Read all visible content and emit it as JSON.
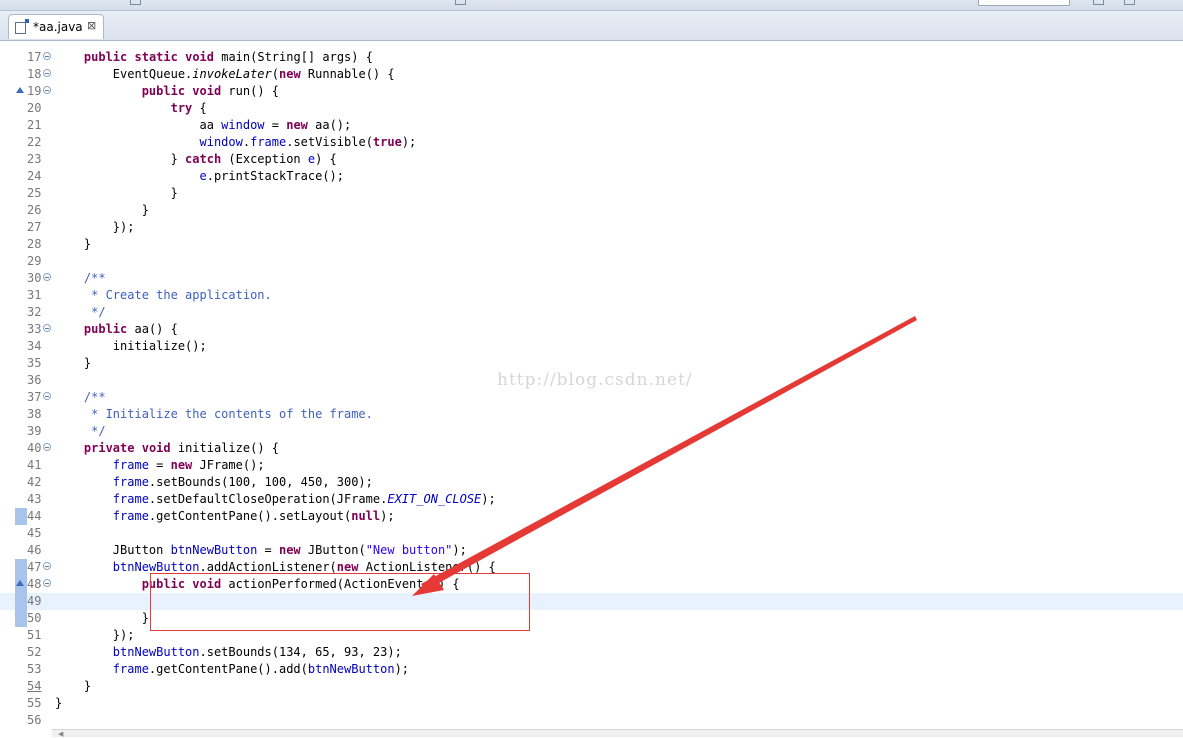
{
  "tab": {
    "label": "*aa.java",
    "close_glyph": "⊠"
  },
  "watermark": "http://blog.csdn.net/",
  "colors": {
    "keyword": "#7f0055",
    "field": "#0000c0",
    "string": "#2a00ff",
    "comment": "#3f5fbf",
    "annotation": "#e53935",
    "current_line": "#e8f2fe"
  },
  "lines": [
    {
      "n": "17",
      "fold": true,
      "tokens": [
        {
          "t": "    "
        },
        {
          "t": "public",
          "c": "kw"
        },
        {
          "t": " "
        },
        {
          "t": "static",
          "c": "kw"
        },
        {
          "t": " "
        },
        {
          "t": "void",
          "c": "kw"
        },
        {
          "t": " main(String[] args) {"
        }
      ]
    },
    {
      "n": "18",
      "fold": true,
      "tokens": [
        {
          "t": "        EventQueue."
        },
        {
          "t": "invokeLater",
          "c": "it"
        },
        {
          "t": "("
        },
        {
          "t": "new",
          "c": "kw"
        },
        {
          "t": " Runnable() {"
        }
      ]
    },
    {
      "n": "19",
      "fold": true,
      "override": true,
      "tokens": [
        {
          "t": "            "
        },
        {
          "t": "public",
          "c": "kw"
        },
        {
          "t": " "
        },
        {
          "t": "void",
          "c": "kw"
        },
        {
          "t": " run() {"
        }
      ]
    },
    {
      "n": "20",
      "tokens": [
        {
          "t": "                "
        },
        {
          "t": "try",
          "c": "kw"
        },
        {
          "t": " {"
        }
      ]
    },
    {
      "n": "21",
      "tokens": [
        {
          "t": "                    aa "
        },
        {
          "t": "window",
          "c": "fld"
        },
        {
          "t": " = "
        },
        {
          "t": "new",
          "c": "kw"
        },
        {
          "t": " aa();"
        }
      ]
    },
    {
      "n": "22",
      "tokens": [
        {
          "t": "                    "
        },
        {
          "t": "window",
          "c": "fld"
        },
        {
          "t": "."
        },
        {
          "t": "frame",
          "c": "fld"
        },
        {
          "t": ".setVisible("
        },
        {
          "t": "true",
          "c": "kw"
        },
        {
          "t": ");"
        }
      ]
    },
    {
      "n": "23",
      "tokens": [
        {
          "t": "                } "
        },
        {
          "t": "catch",
          "c": "kw"
        },
        {
          "t": " (Exception "
        },
        {
          "t": "e",
          "c": "fld"
        },
        {
          "t": ") {"
        }
      ]
    },
    {
      "n": "24",
      "tokens": [
        {
          "t": "                    "
        },
        {
          "t": "e",
          "c": "fld"
        },
        {
          "t": ".printStackTrace();"
        }
      ]
    },
    {
      "n": "25",
      "tokens": [
        {
          "t": "                }"
        }
      ]
    },
    {
      "n": "26",
      "tokens": [
        {
          "t": "            }"
        }
      ]
    },
    {
      "n": "27",
      "tokens": [
        {
          "t": "        });"
        }
      ]
    },
    {
      "n": "28",
      "tokens": [
        {
          "t": "    }"
        }
      ]
    },
    {
      "n": "29",
      "tokens": [
        {
          "t": ""
        }
      ]
    },
    {
      "n": "30",
      "fold": true,
      "tokens": [
        {
          "t": "    "
        },
        {
          "t": "/**",
          "c": "cmt"
        }
      ]
    },
    {
      "n": "31",
      "tokens": [
        {
          "t": "     "
        },
        {
          "t": "* Create the application.",
          "c": "cmt"
        }
      ]
    },
    {
      "n": "32",
      "tokens": [
        {
          "t": "     "
        },
        {
          "t": "*/",
          "c": "cmt"
        }
      ]
    },
    {
      "n": "33",
      "fold": true,
      "tokens": [
        {
          "t": "    "
        },
        {
          "t": "public",
          "c": "kw"
        },
        {
          "t": " aa() {"
        }
      ]
    },
    {
      "n": "34",
      "tokens": [
        {
          "t": "        initialize();"
        }
      ]
    },
    {
      "n": "35",
      "tokens": [
        {
          "t": "    }"
        }
      ]
    },
    {
      "n": "36",
      "tokens": [
        {
          "t": ""
        }
      ]
    },
    {
      "n": "37",
      "fold": true,
      "tokens": [
        {
          "t": "    "
        },
        {
          "t": "/**",
          "c": "cmt"
        }
      ]
    },
    {
      "n": "38",
      "tokens": [
        {
          "t": "     "
        },
        {
          "t": "* Initialize the contents of the frame.",
          "c": "cmt"
        }
      ]
    },
    {
      "n": "39",
      "tokens": [
        {
          "t": "     "
        },
        {
          "t": "*/",
          "c": "cmt"
        }
      ]
    },
    {
      "n": "40",
      "fold": true,
      "tokens": [
        {
          "t": "    "
        },
        {
          "t": "private",
          "c": "kw"
        },
        {
          "t": " "
        },
        {
          "t": "void",
          "c": "kw"
        },
        {
          "t": " initialize() {"
        }
      ]
    },
    {
      "n": "41",
      "tokens": [
        {
          "t": "        "
        },
        {
          "t": "frame",
          "c": "fld"
        },
        {
          "t": " = "
        },
        {
          "t": "new",
          "c": "kw"
        },
        {
          "t": " JFrame();"
        }
      ]
    },
    {
      "n": "42",
      "tokens": [
        {
          "t": "        "
        },
        {
          "t": "frame",
          "c": "fld"
        },
        {
          "t": ".setBounds(100, 100, 450, 300);"
        }
      ]
    },
    {
      "n": "43",
      "tokens": [
        {
          "t": "        "
        },
        {
          "t": "frame",
          "c": "fld"
        },
        {
          "t": ".setDefaultCloseOperation(JFrame."
        },
        {
          "t": "EXIT_ON_CLOSE",
          "c": "cst"
        },
        {
          "t": ");"
        }
      ]
    },
    {
      "n": "44",
      "changed": true,
      "tokens": [
        {
          "t": "        "
        },
        {
          "t": "frame",
          "c": "fld"
        },
        {
          "t": ".getContentPane().setLayout("
        },
        {
          "t": "null",
          "c": "kw"
        },
        {
          "t": ");"
        }
      ]
    },
    {
      "n": "45",
      "tokens": [
        {
          "t": ""
        }
      ]
    },
    {
      "n": "46",
      "tokens": [
        {
          "t": "        JButton "
        },
        {
          "t": "btnNewButton",
          "c": "fld"
        },
        {
          "t": " = "
        },
        {
          "t": "new",
          "c": "kw"
        },
        {
          "t": " JButton("
        },
        {
          "t": "\"New button\"",
          "c": "str"
        },
        {
          "t": ");"
        }
      ]
    },
    {
      "n": "47",
      "fold": true,
      "changed": true,
      "tokens": [
        {
          "t": "        "
        },
        {
          "t": "btnNewButton",
          "c": "fld"
        },
        {
          "t": ".addActionListener("
        },
        {
          "t": "new",
          "c": "kw"
        },
        {
          "t": " ActionListener() {"
        }
      ]
    },
    {
      "n": "48",
      "fold": true,
      "override": true,
      "changed": true,
      "tokens": [
        {
          "t": "            "
        },
        {
          "t": "public",
          "c": "kw"
        },
        {
          "t": " "
        },
        {
          "t": "void",
          "c": "kw"
        },
        {
          "t": " actionPerformed(ActionEvent "
        },
        {
          "t": "e",
          "c": "fld"
        },
        {
          "t": ") {"
        }
      ]
    },
    {
      "n": "49",
      "current": true,
      "changed": true,
      "tokens": [
        {
          "t": ""
        }
      ]
    },
    {
      "n": "50",
      "changed": true,
      "tokens": [
        {
          "t": "            }"
        }
      ]
    },
    {
      "n": "51",
      "tokens": [
        {
          "t": "        });"
        }
      ]
    },
    {
      "n": "52",
      "tokens": [
        {
          "t": "        "
        },
        {
          "t": "btnNewButton",
          "c": "fld"
        },
        {
          "t": ".setBounds(134, 65, 93, 23);"
        }
      ]
    },
    {
      "n": "53",
      "tokens": [
        {
          "t": "        "
        },
        {
          "t": "frame",
          "c": "fld"
        },
        {
          "t": ".getContentPane().add("
        },
        {
          "t": "btnNewButton",
          "c": "fld"
        },
        {
          "t": ");"
        }
      ]
    },
    {
      "n": "54",
      "underline": true,
      "tokens": [
        {
          "t": "    }"
        }
      ]
    },
    {
      "n": "55",
      "tokens": [
        {
          "t": "}"
        }
      ]
    },
    {
      "n": "56",
      "tokens": [
        {
          "t": ""
        }
      ]
    }
  ]
}
